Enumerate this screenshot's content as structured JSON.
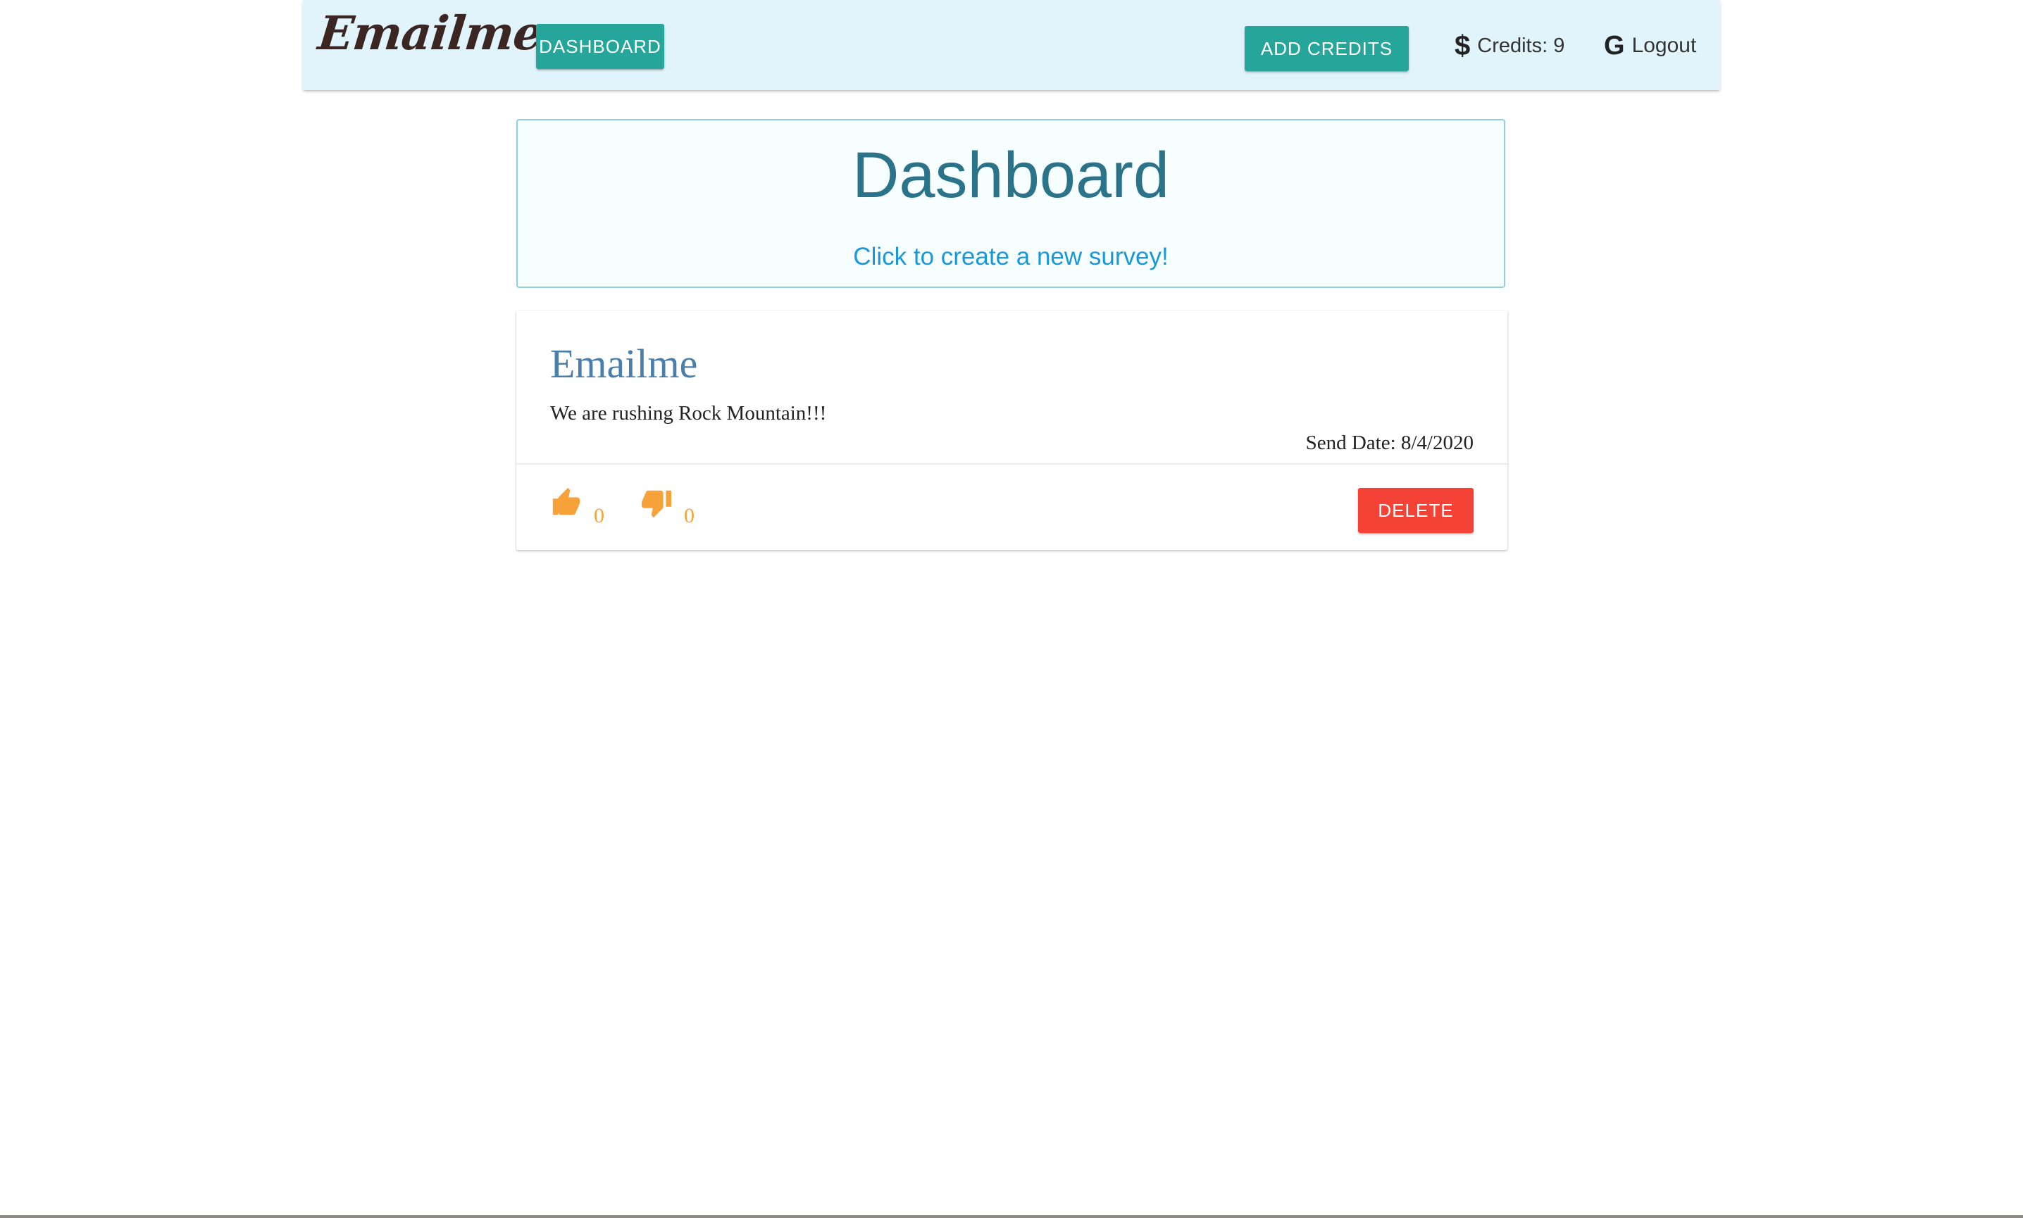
{
  "navbar": {
    "brand": "Emailme",
    "dashboard_label": "DASHBOARD",
    "add_credits_label": "ADD CREDITS",
    "credits_label": "Credits: 9",
    "logout_label": "Logout",
    "icons": {
      "credits": "dollar-icon",
      "logout": "google-icon"
    },
    "colors": {
      "background": "#e1f4fc",
      "button": "#26a69a"
    }
  },
  "header": {
    "title": "Dashboard",
    "create_link": "Click to create a new survey!"
  },
  "surveys": [
    {
      "title": "Emailme",
      "body": "We are rushing Rock Mountain!!!",
      "send_date": "Send Date: 8/4/2020",
      "yes_count": "0",
      "no_count": "0",
      "delete_label": "DELETE",
      "icons": {
        "yes": "thumbs-up-icon",
        "no": "thumbs-down-icon"
      }
    }
  ],
  "colors": {
    "accent": "#26a69a",
    "danger": "#f44336",
    "vote": "#f7a13a",
    "title": "#2a7389",
    "link": "#1a98d6"
  }
}
